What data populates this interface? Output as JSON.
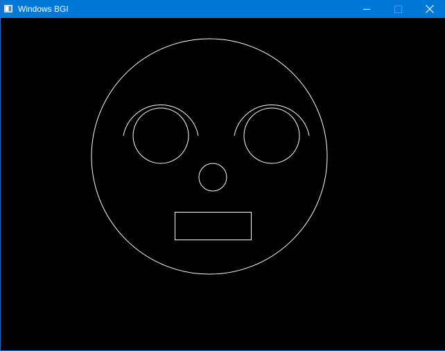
{
  "window": {
    "title": "Windows BGI",
    "icon": "app-window-icon",
    "controls": {
      "minimize_icon": "minimize-icon",
      "maximize_icon": "maximize-icon",
      "close_icon": "close-icon"
    }
  },
  "colors": {
    "titlebar": "#0078d7",
    "title_text": "#ffffff",
    "maximize_disabled": "#4f9be3",
    "canvas_background": "#000000",
    "drawing_stroke": "#ffffff"
  },
  "drawing": {
    "shapes": [
      "face-outline",
      "left-eyebrow-arc",
      "right-eyebrow-arc",
      "left-eye",
      "right-eye",
      "nose",
      "mouth"
    ]
  }
}
